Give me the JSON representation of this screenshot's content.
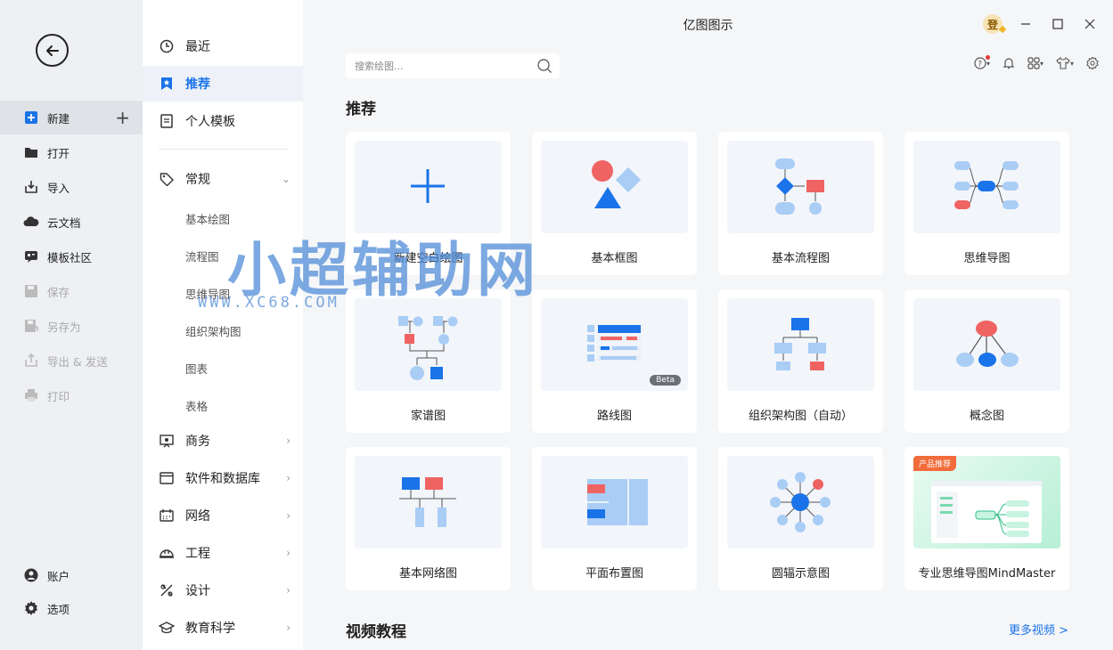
{
  "app": {
    "title": "亿图图示",
    "avatar_text": "登"
  },
  "left_rail": {
    "items": [
      {
        "label": "新建",
        "icon": "new-file-icon"
      },
      {
        "label": "打开",
        "icon": "folder-icon"
      },
      {
        "label": "导入",
        "icon": "import-icon"
      },
      {
        "label": "云文档",
        "icon": "cloud-icon"
      },
      {
        "label": "模板社区",
        "icon": "community-icon"
      },
      {
        "label": "保存",
        "icon": "save-icon"
      },
      {
        "label": "另存为",
        "icon": "save-as-icon"
      },
      {
        "label": "导出 & 发送",
        "icon": "export-icon"
      },
      {
        "label": "打印",
        "icon": "print-icon"
      },
      {
        "label": "账户",
        "icon": "account-icon"
      },
      {
        "label": "选项",
        "icon": "gear-icon"
      }
    ],
    "new_plus": "+"
  },
  "categories": {
    "top": [
      {
        "label": "最近",
        "icon": "clock-icon"
      },
      {
        "label": "推荐",
        "icon": "star-icon"
      },
      {
        "label": "个人模板",
        "icon": "template-icon"
      }
    ],
    "general": {
      "label": "常规",
      "icon": "tag-icon"
    },
    "general_subs": [
      "基本绘图",
      "流程图",
      "思维导图",
      "组织架构图",
      "图表",
      "表格"
    ],
    "more": [
      {
        "label": "商务",
        "icon": "presentation-icon"
      },
      {
        "label": "软件和数据库",
        "icon": "window-icon"
      },
      {
        "label": "网络",
        "icon": "network-icon"
      },
      {
        "label": "工程",
        "icon": "helmet-icon"
      },
      {
        "label": "设计",
        "icon": "design-icon"
      },
      {
        "label": "教育科学",
        "icon": "graduation-icon"
      }
    ]
  },
  "search": {
    "placeholder": "搜索绘图..."
  },
  "main": {
    "section_recommend": "推荐",
    "section_video": "视频教程",
    "more_videos": "更多视频 >",
    "cards": [
      {
        "label": "新建空白绘图"
      },
      {
        "label": "基本框图"
      },
      {
        "label": "基本流程图"
      },
      {
        "label": "思维导图"
      },
      {
        "label": "家谱图"
      },
      {
        "label": "路线图",
        "badge": "Beta"
      },
      {
        "label": "组织架构图（自动）"
      },
      {
        "label": "概念图"
      },
      {
        "label": "基本网络图"
      },
      {
        "label": "平面布置图"
      },
      {
        "label": "圆辐示意图"
      },
      {
        "label": "专业思维导图MindMaster",
        "badge": "产品推荐"
      }
    ]
  },
  "watermark": {
    "big": "小超辅助网",
    "small": "WWW.XC68.COM"
  },
  "colors": {
    "accent": "#1a73e8",
    "red": "#f06363",
    "blue_light": "#a9cdf5",
    "blue": "#1a73e8"
  }
}
